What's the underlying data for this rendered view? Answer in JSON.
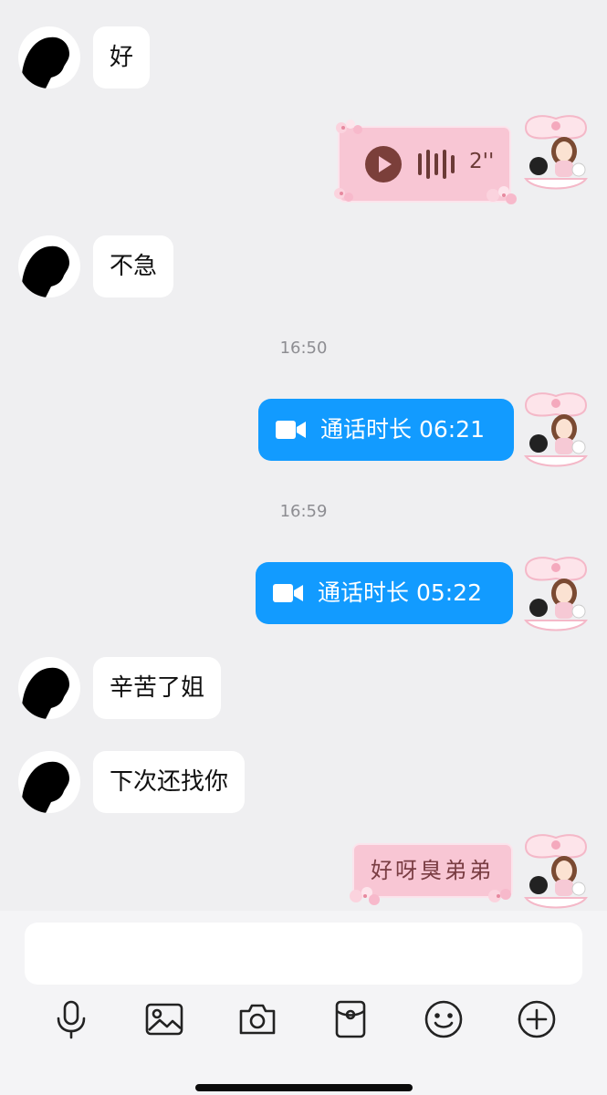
{
  "messages": {
    "m1": {
      "sender": "other",
      "text": "好"
    },
    "m2": {
      "sender": "me",
      "type": "voice",
      "duration": "2''"
    },
    "m3": {
      "sender": "other",
      "text": "不急"
    },
    "t1": "16:50",
    "m4": {
      "sender": "me",
      "type": "video-call",
      "text": "通话时长 06:21"
    },
    "t2": "16:59",
    "m5": {
      "sender": "me",
      "type": "video-call",
      "text": "通话时长 05:22"
    },
    "m6": {
      "sender": "other",
      "text": "辛苦了姐"
    },
    "m7": {
      "sender": "other",
      "text": "下次还找你"
    },
    "m8": {
      "sender": "me",
      "type": "sticker-text",
      "text": "好呀臭弟弟"
    }
  },
  "input": {
    "placeholder": ""
  },
  "toolbar": {
    "icons": [
      "microphone-icon",
      "image-icon",
      "camera-icon",
      "red-packet-icon",
      "emoji-icon",
      "plus-icon"
    ]
  },
  "colors": {
    "background": "#efeff1",
    "bubble_other": "#ffffff",
    "call_bubble": "#129bff",
    "pink_bubble": "#f8c6d4"
  }
}
